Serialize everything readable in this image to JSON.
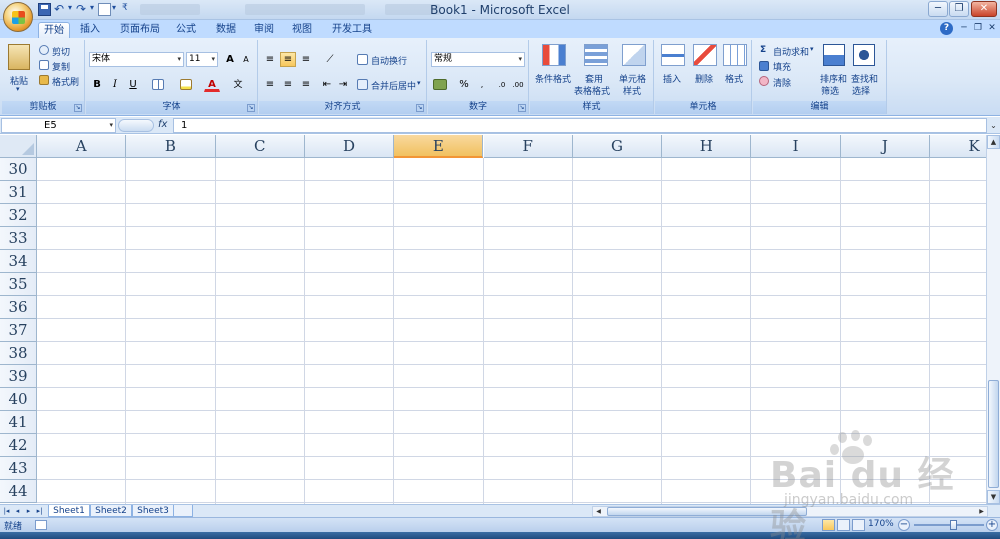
{
  "window": {
    "title": "Book1 - Microsoft Excel",
    "min_label": "─",
    "restore_label": "❐",
    "close_label": "✕"
  },
  "quick_access": {
    "undo_glyph": "↶",
    "redo_glyph": "↷",
    "dropdown_glyph": "▾",
    "customize_glyph": "₹"
  },
  "ribbon_tabs": [
    {
      "label": "开始",
      "active": true
    },
    {
      "label": "插入"
    },
    {
      "label": "页面布局"
    },
    {
      "label": "公式"
    },
    {
      "label": "数据"
    },
    {
      "label": "审阅"
    },
    {
      "label": "视图"
    },
    {
      "label": "开发工具"
    }
  ],
  "help_glyph": "?",
  "ribbon": {
    "clipboard": {
      "label": "剪贴板",
      "paste": "粘贴",
      "cut": "剪切",
      "copy": "复制",
      "format_painter": "格式刷"
    },
    "font": {
      "label": "字体",
      "font_name": "宋体",
      "font_size": "11",
      "grow": "A",
      "shrink": "A",
      "bold": "B",
      "italic": "I",
      "underline": "U",
      "font_color_glyph": "A",
      "phonetic_glyph": "文"
    },
    "alignment": {
      "label": "对齐方式",
      "wrap_text": "自动换行",
      "merge_center": "合并后居中"
    },
    "number": {
      "label": "数字",
      "format": "常规",
      "percent": "%"
    },
    "styles": {
      "label": "样式",
      "conditional": "条件格式",
      "table_line1": "套用",
      "table_line2": "表格格式",
      "cell_line1": "单元格",
      "cell_line2": "样式"
    },
    "cells": {
      "label": "单元格",
      "insert": "插入",
      "delete": "删除",
      "format": "格式"
    },
    "editing": {
      "label": "编辑",
      "autosum": "自动求和",
      "fill": "填充",
      "clear": "清除",
      "sort_line1": "排序和",
      "sort_line2": "筛选",
      "find_line1": "查找和",
      "find_line2": "选择"
    }
  },
  "formula_bar": {
    "name_box": "E5",
    "fx_label": "fx",
    "value": "1",
    "expand_glyph": "⌄"
  },
  "columns": [
    "A",
    "B",
    "C",
    "D",
    "E",
    "F",
    "G",
    "H",
    "I",
    "J",
    "K"
  ],
  "selected_column": "E",
  "rows": [
    "30",
    "31",
    "32",
    "33",
    "34",
    "35",
    "36",
    "37",
    "38",
    "39",
    "40",
    "41",
    "42",
    "43",
    "44"
  ],
  "sheets": [
    "Sheet1",
    "Sheet2",
    "Sheet3"
  ],
  "active_sheet": "Sheet1",
  "sheet_nav": [
    "|◂",
    "◂",
    "▸",
    "▸|"
  ],
  "status": {
    "ready": "就绪",
    "zoom": "170%",
    "zoom_out": "−",
    "zoom_in": "+"
  },
  "watermark": {
    "brand": "Bai  du 经验",
    "url": "jingyan.baidu.com"
  },
  "colors": {
    "accent": "#15428b",
    "selected_header": "#f1c15f",
    "ribbon_bg": "#dbe8f7",
    "grid_line": "#d0d7e5"
  }
}
